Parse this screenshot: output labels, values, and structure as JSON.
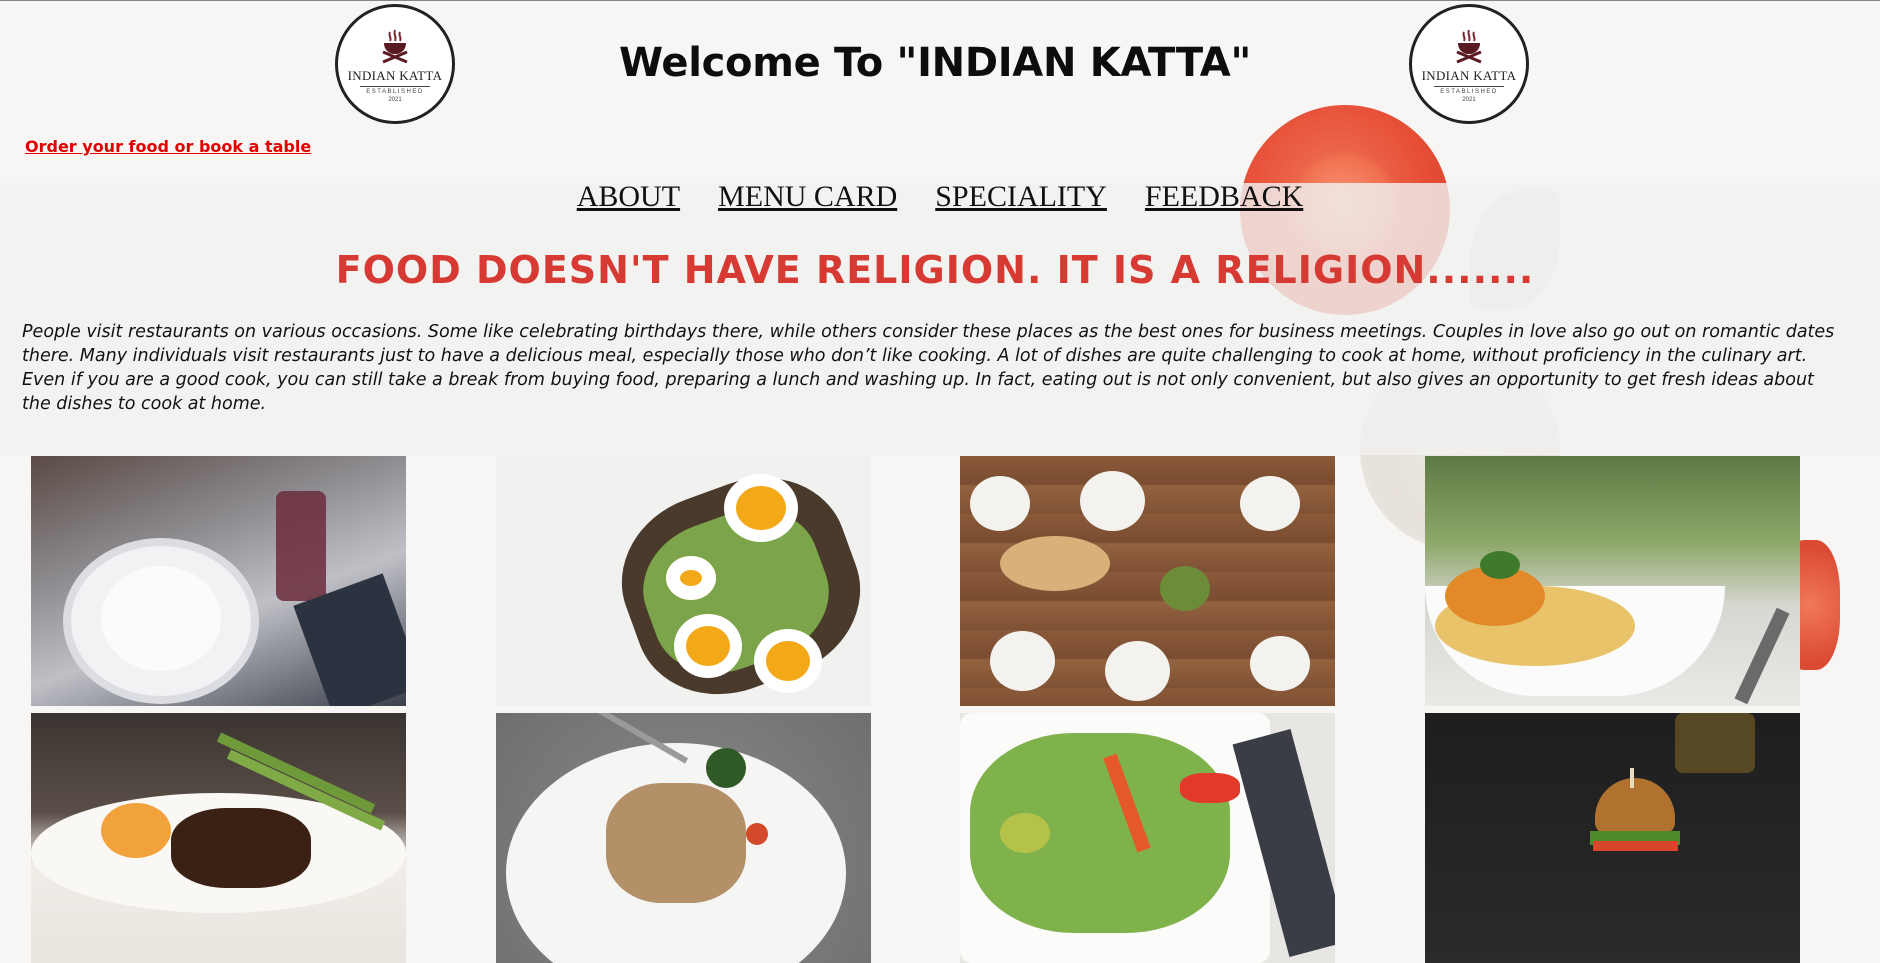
{
  "header": {
    "logo_left": {
      "name": "INDIAN KATTA",
      "established": "ESTABLISHED",
      "year": "2021"
    },
    "logo_right": {
      "name": "INDIAN KATTA",
      "established": "ESTABLISHED",
      "year": "2021"
    },
    "title": "Welcome To \"INDIAN KATTA\"",
    "order_link": "Order your food or book a table"
  },
  "nav": {
    "items": [
      {
        "label": "ABOUT"
      },
      {
        "label": "MENU CARD"
      },
      {
        "label": "SPECIALITY"
      },
      {
        "label": "FEEDBACK"
      }
    ]
  },
  "main": {
    "tagline": "FOOD DOESN'T HAVE RELIGION. IT IS A RELIGION.......",
    "intro": "People visit restaurants on various occasions. Some like celebrating birthdays there, while others consider these places as the best ones for business meetings. Couples in love also go out on romantic dates there. Many individuals visit restaurants just to have a delicious meal, especially those who don’t like cooking. A lot of dishes are quite challenging to cook at home, without proficiency in the culinary art. Even if you are a good cook, you can still take a break from buying food, preparing a lunch and washing up. In fact, eating out is not only convenient, but also gives an opportunity to get fresh ideas about the dishes to cook at home."
  },
  "gallery": {
    "photos": [
      {
        "subject": "table-setting-photo"
      },
      {
        "subject": "avocado-egg-toast-photo"
      },
      {
        "subject": "shared-table-dishes-photo"
      },
      {
        "subject": "spaghetti-plate-photo"
      },
      {
        "subject": "steak-asparagus-photo"
      },
      {
        "subject": "pasta-fork-photo"
      },
      {
        "subject": "salad-plate-photo"
      },
      {
        "subject": "burger-photo"
      }
    ]
  },
  "colors": {
    "accent_red": "#d63a32",
    "link_red": "#e00000",
    "title_black": "#0d0d0d"
  }
}
